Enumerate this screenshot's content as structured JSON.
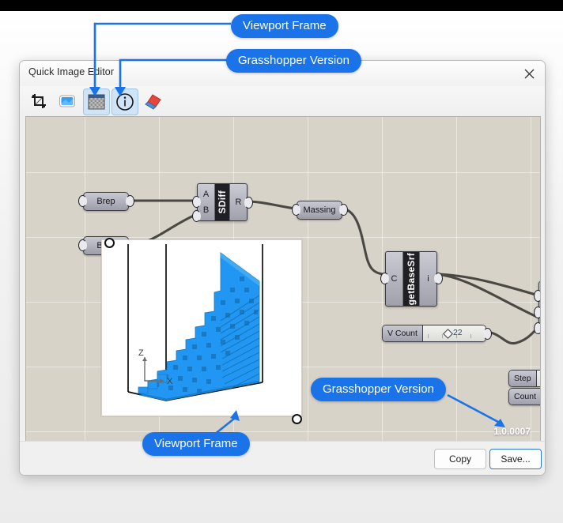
{
  "dialog": {
    "title": "Quick Image Editor",
    "close_icon": "close-icon",
    "toolbar": [
      {
        "name": "crop-tool",
        "selected": false
      },
      {
        "name": "background-tool",
        "selected": false
      },
      {
        "name": "transparency-tool",
        "selected": true
      },
      {
        "name": "info-tool",
        "selected": true
      },
      {
        "name": "eraser-tool",
        "selected": false
      }
    ],
    "buttons": {
      "copy": "Copy",
      "save": "Save..."
    }
  },
  "canvas": {
    "version_label": "1.0.0007",
    "params": [
      {
        "label": "Brep"
      },
      {
        "label": "Brep"
      },
      {
        "label": "Massing"
      }
    ],
    "components": [
      {
        "title": "SDiff",
        "inputs": [
          "A",
          "B"
        ],
        "outputs": [
          "R"
        ]
      },
      {
        "title": "getBaseSrf",
        "inputs": [
          "C"
        ],
        "outputs": [
          "i"
        ]
      }
    ],
    "sliders": [
      {
        "name": "V Count",
        "value": "22"
      },
      {
        "name": "Step",
        "value": ""
      },
      {
        "name": "Count",
        "value": ""
      }
    ]
  },
  "viewport": {
    "axis_z": "Z",
    "axis_x": "X"
  },
  "callouts": [
    {
      "label": "Viewport Frame",
      "id": "callout-viewport-frame-top"
    },
    {
      "label": "Grasshopper Version",
      "id": "callout-grasshopper-version-top"
    },
    {
      "label": "Grasshopper Version",
      "id": "callout-grasshopper-version-canvas"
    },
    {
      "label": "Viewport Frame",
      "id": "callout-viewport-frame-bottom"
    }
  ],
  "colors": {
    "accent": "#1a73e8",
    "canvas_bg": "#d7d3c9",
    "geometry_light": "#2196f3",
    "geometry_dark": "#1a7cc4"
  }
}
